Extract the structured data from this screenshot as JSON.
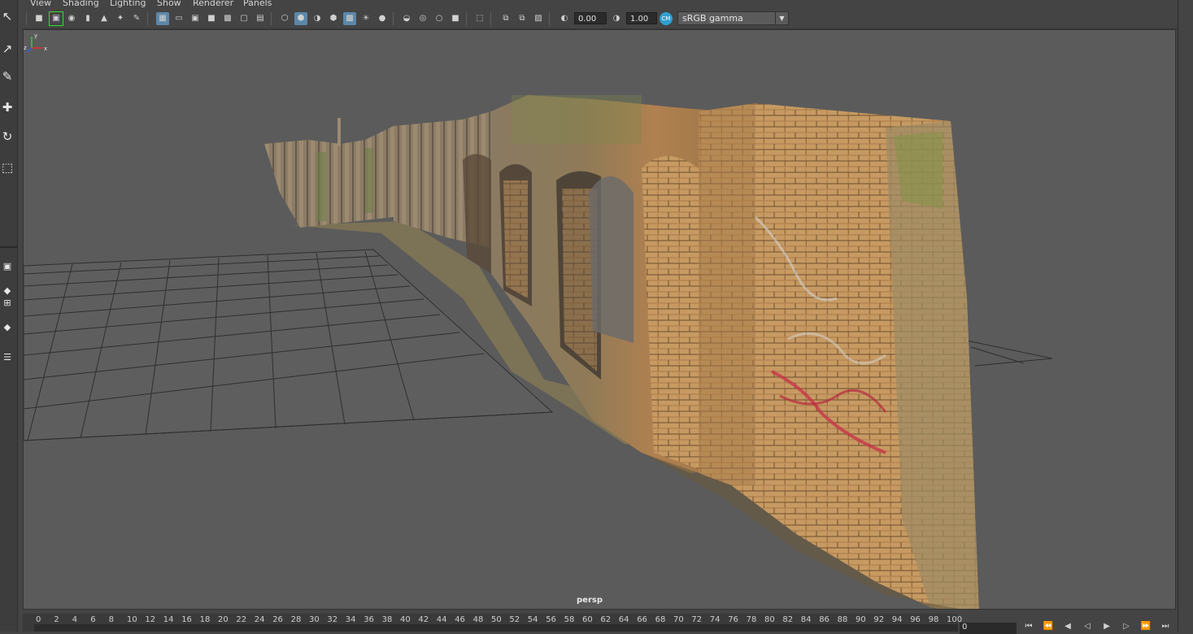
{
  "menu": {
    "items": [
      "View",
      "Shading",
      "Lighting",
      "Show",
      "Renderer",
      "Panels"
    ]
  },
  "toolbar": {
    "exposure_value": "0.00",
    "gamma_value": "1.00",
    "color_space": "sRGB gamma",
    "icons": [
      "camera-icon",
      "camera-attributes-icon",
      "bookmark-icon",
      "image-plane-icon",
      "grid-icon",
      "film-gate-icon",
      "resolution-gate-icon",
      "gate-mask-icon",
      "field-chart-icon",
      "safe-action-icon",
      "safe-title-icon",
      "wireframe-icon",
      "smooth-shade-icon",
      "use-default-material-icon",
      "wireframe-on-shaded-icon",
      "textured-icon",
      "use-all-lights-icon",
      "shadows-icon",
      "screen-space-ao-icon",
      "motion-blur-icon",
      "multisample-aa-icon",
      "depth-of-field-icon",
      "isolate-select-icon",
      "xray-icon",
      "xray-active-components-icon",
      "xray-joints-icon",
      "exposure-icon",
      "gamma-icon",
      "color-management-icon"
    ]
  },
  "tools": [
    "select-tool-icon",
    "lasso-tool-icon",
    "paint-select-tool-icon",
    "move-tool-icon",
    "rotate-tool-icon",
    "scale-tool-icon"
  ],
  "viewport": {
    "camera_label": "persp",
    "axis": {
      "x": "x",
      "y": "y",
      "z": "z"
    }
  },
  "timeline": {
    "ticks": [
      "0",
      "2",
      "4",
      "6",
      "8",
      "10",
      "12",
      "14",
      "16",
      "18",
      "20",
      "22",
      "24",
      "26",
      "28",
      "30",
      "32",
      "34",
      "36",
      "38",
      "40",
      "42",
      "44",
      "46",
      "48",
      "50",
      "52",
      "54",
      "56",
      "58",
      "60",
      "62",
      "64",
      "66",
      "68",
      "70",
      "72",
      "74",
      "76",
      "78",
      "80",
      "82",
      "84",
      "86",
      "88",
      "90",
      "92",
      "94",
      "96",
      "98",
      "100"
    ],
    "current_frame": "0",
    "playback_controls": [
      "go-to-start-icon",
      "step-back-key-icon",
      "step-back-frame-icon",
      "play-backwards-icon",
      "play-forwards-icon",
      "step-forward-frame-icon",
      "step-forward-key-icon",
      "go-to-end-icon"
    ]
  },
  "colors": {
    "viewport_bg": "#5b5b5b",
    "ui_bg": "#444444",
    "active_button": "#5c87a8",
    "highlight_green": "#2fe02f",
    "color_management_blue": "#2f9fd0"
  }
}
